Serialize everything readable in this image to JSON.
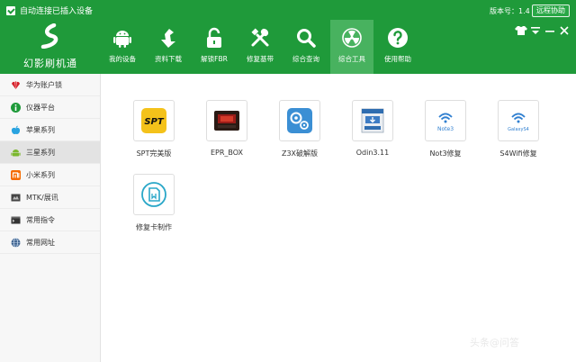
{
  "titlebar": {
    "auto_connect": "自动连接已插入设备",
    "version": "版本号：1.4",
    "remote_help": "远程协助"
  },
  "logo": {
    "text": "幻影刷机通"
  },
  "nav": {
    "items": [
      {
        "label": "我的设备",
        "icon": "android-icon"
      },
      {
        "label": "资料下载",
        "icon": "download-arrow-icon"
      },
      {
        "label": "解锁FBR",
        "icon": "unlock-icon"
      },
      {
        "label": "修复基带",
        "icon": "tools-icon"
      },
      {
        "label": "综合查询",
        "icon": "search-icon"
      },
      {
        "label": "综合工具",
        "icon": "radiation-icon",
        "active": true
      },
      {
        "label": "使用帮助",
        "icon": "help-icon"
      }
    ]
  },
  "sidebar": {
    "items": [
      {
        "label": "华为账户锁",
        "icon": "huawei-icon"
      },
      {
        "label": "仪器平台",
        "icon": "info-icon"
      },
      {
        "label": "苹果系列",
        "icon": "apple-icon"
      },
      {
        "label": "三星系列",
        "icon": "android-icon",
        "active": true
      },
      {
        "label": "小米系列",
        "icon": "mi-icon"
      },
      {
        "label": "MTK/展讯",
        "icon": "chip-icon"
      },
      {
        "label": "常用指令",
        "icon": "terminal-icon"
      },
      {
        "label": "常用网址",
        "icon": "globe-icon"
      }
    ]
  },
  "tools": {
    "items": [
      {
        "label": "SPT完美版",
        "text": "SPT"
      },
      {
        "label": "EPR_BOX"
      },
      {
        "label": "Z3X破解版"
      },
      {
        "label": "Odin3.11"
      },
      {
        "label": "Not3修复",
        "text": "Note3"
      },
      {
        "label": "S4Wifi修复",
        "text": "GalaxyS4"
      },
      {
        "label": "修复卡制作"
      }
    ]
  },
  "watermark": {
    "text": "头条@问答"
  },
  "colors": {
    "brand_green": "#1f9a3a",
    "active_nav": "#48b25f",
    "sidebar_bg": "#f7f7f7"
  }
}
